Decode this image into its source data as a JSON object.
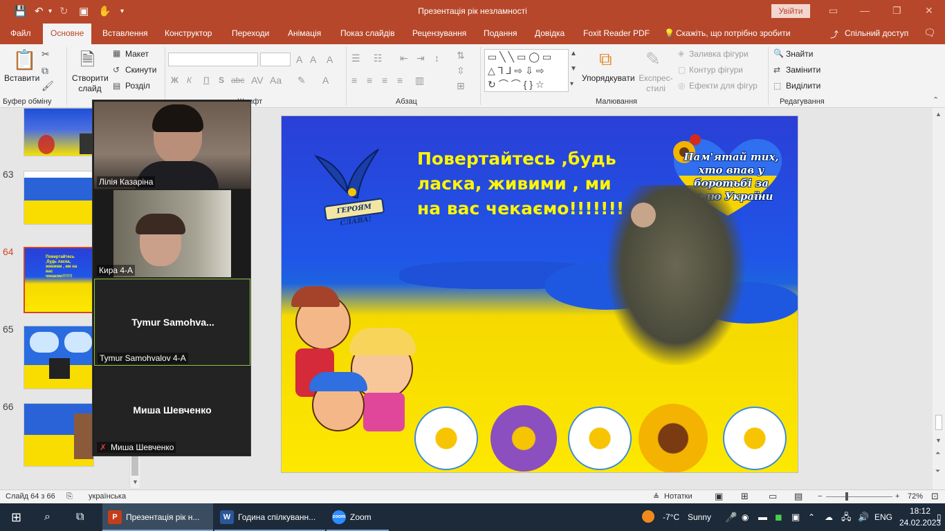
{
  "window": {
    "title": "Презентація рік незламності",
    "sign_in": "Увійти",
    "controls": [
      "▭",
      "—",
      "❐",
      "✕"
    ]
  },
  "tabs": [
    "Файл",
    "Основне",
    "Вставлення",
    "Конструктор",
    "Переходи",
    "Анімація",
    "Показ слайдів",
    "Рецензування",
    "Подання",
    "Довідка",
    "Foxit Reader PDF",
    "Скажіть, що потрібно зробити",
    "Спільний доступ"
  ],
  "active_tab": "Основне",
  "ribbon": {
    "clipboard": {
      "paste": "Вставити",
      "group": "Буфер обміну"
    },
    "slides": {
      "new_slide": "Створити слайд",
      "layout": "Макет",
      "reset": "Скинути",
      "section": "Розділ",
      "group": "Слайди"
    },
    "font": {
      "bold": "Ж",
      "italic": "К",
      "underline": "П",
      "shadow": "S",
      "strike": "abc",
      "group": "Шрифт"
    },
    "paragraph": {
      "group": "Абзац"
    },
    "drawing": {
      "arrange": "Упорядкувати",
      "quick_styles": "Експрес-стилі",
      "fill": "Заливка фігури",
      "outline": "Контур фігури",
      "effects": "Ефекти для фігур",
      "group": "Малювання"
    },
    "editing": {
      "find": "Знайти",
      "replace": "Замінити",
      "select": "Виділити",
      "group": "Редагування"
    }
  },
  "thumbnails": [
    {
      "num": "63"
    },
    {
      "num": "64",
      "selected": true
    },
    {
      "num": "65"
    },
    {
      "num": "66"
    }
  ],
  "slide": {
    "headline": "Повертайтесь ,будь ласка, живими , ми на вас чекаємо!!!!!!!",
    "heart_text": "Пам'ятай тих, хто впав у боротьбі за волю України",
    "banner": "ГЕРОЯМ СЛАВА!"
  },
  "zoom": {
    "participants": [
      {
        "name": "Лілія Казаріна",
        "video": true
      },
      {
        "name": "Кира 4-А",
        "video": true
      },
      {
        "name": "Tymur Samohvalov 4-A",
        "display": "Tymur  Samohva...",
        "video": false,
        "active": true
      },
      {
        "name": "Миша Шевченко",
        "display": "Миша Шевченко",
        "video": false,
        "muted": true
      }
    ]
  },
  "status": {
    "slide_counter": "Слайд 64 з 66",
    "language": "українська",
    "notes": "Нотатки",
    "zoom_level": "72%"
  },
  "taskbar": {
    "apps": [
      {
        "label": "Презентація рік н...",
        "icon": "P",
        "color": "#c43e1c",
        "active": true
      },
      {
        "label": "Година спілкуванн...",
        "icon": "W",
        "color": "#2b579a"
      },
      {
        "label": "Zoom",
        "icon": "zoom",
        "color": "#2d8cff"
      }
    ],
    "weather_temp": "-7°C",
    "weather_desc": "Sunny",
    "lang": "ENG",
    "time": "18:12",
    "date": "24.02.2023"
  }
}
